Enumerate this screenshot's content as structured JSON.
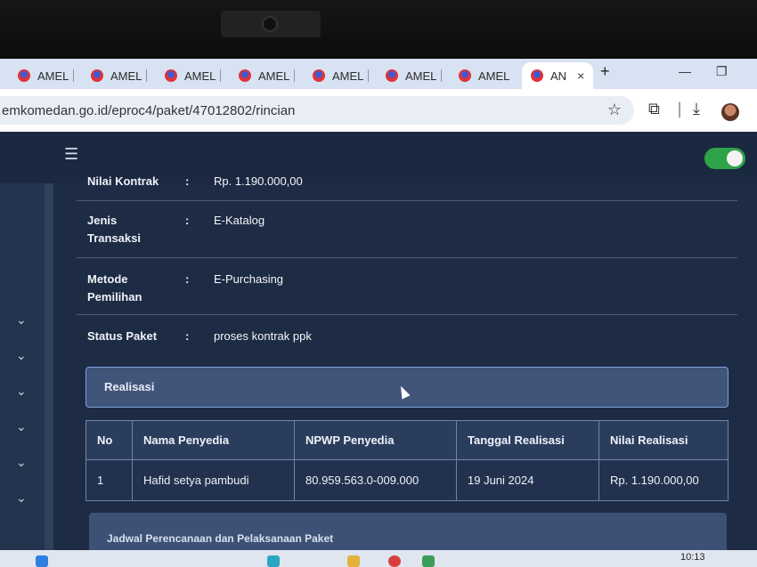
{
  "browser": {
    "tabs": [
      {
        "label": "AMEL"
      },
      {
        "label": "AMEL"
      },
      {
        "label": "AMEL"
      },
      {
        "label": "AMEL"
      },
      {
        "label": "AMEL"
      },
      {
        "label": "AMEL"
      },
      {
        "label": "AMEL"
      },
      {
        "label": "AN",
        "active": true
      }
    ],
    "tab_close": "×",
    "new_tab": "+",
    "url": "emkomedan.go.id/eproc4/paket/47012802/rincian"
  },
  "details": [
    {
      "label": "Nilai Kontrak",
      "value": "Rp. 1.190.000,00"
    },
    {
      "label": "Jenis Transaksi",
      "value": "E-Katalog"
    },
    {
      "label": "Metode Pemilihan",
      "value": "E-Purchasing"
    },
    {
      "label": "Status Paket",
      "value": "proses kontrak ppk"
    }
  ],
  "colon": ":",
  "realisasi": {
    "title": "Realisasi",
    "columns": [
      "No",
      "Nama Penyedia",
      "NPWP Penyedia",
      "Tanggal Realisasi",
      "Nilai Realisasi"
    ],
    "rows": [
      [
        "1",
        "Hafid setya pambudi",
        "80.959.563.0-009.000",
        "19 Juni 2024",
        "Rp. 1.190.000,00"
      ]
    ]
  },
  "jadwal": {
    "title": "Jadwal Perencanaan dan Pelaksanaan Paket"
  },
  "taskbar": {
    "clock": "10:13"
  },
  "colors": {
    "toggle_on": "#2fa34a",
    "section_border": "#7aa0d8"
  }
}
